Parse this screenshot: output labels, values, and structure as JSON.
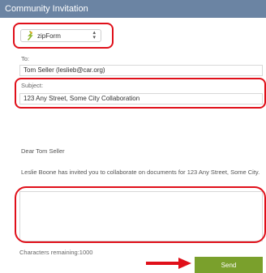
{
  "window": {
    "title": "Community Invitation"
  },
  "app_selector": {
    "value": "zipForm",
    "icon": "zipform-logo-icon"
  },
  "to": {
    "label": "To:",
    "value": "Tom Seller (leslieb@car.org)"
  },
  "subject": {
    "label": "Subject:",
    "value": "123 Any Street, Some City Collaboration"
  },
  "message": {
    "greeting": "Dear Tom Seller",
    "body": "Leslie Boone has invited you to collaborate on documents for 123 Any Street, Some City.",
    "input_value": ""
  },
  "characters_remaining": "Characters remaining:1000",
  "send_button": {
    "label": "Send"
  },
  "colors": {
    "titlebar": "#6b84a3",
    "highlight": "#e0101a",
    "send": "#7aa02c"
  }
}
